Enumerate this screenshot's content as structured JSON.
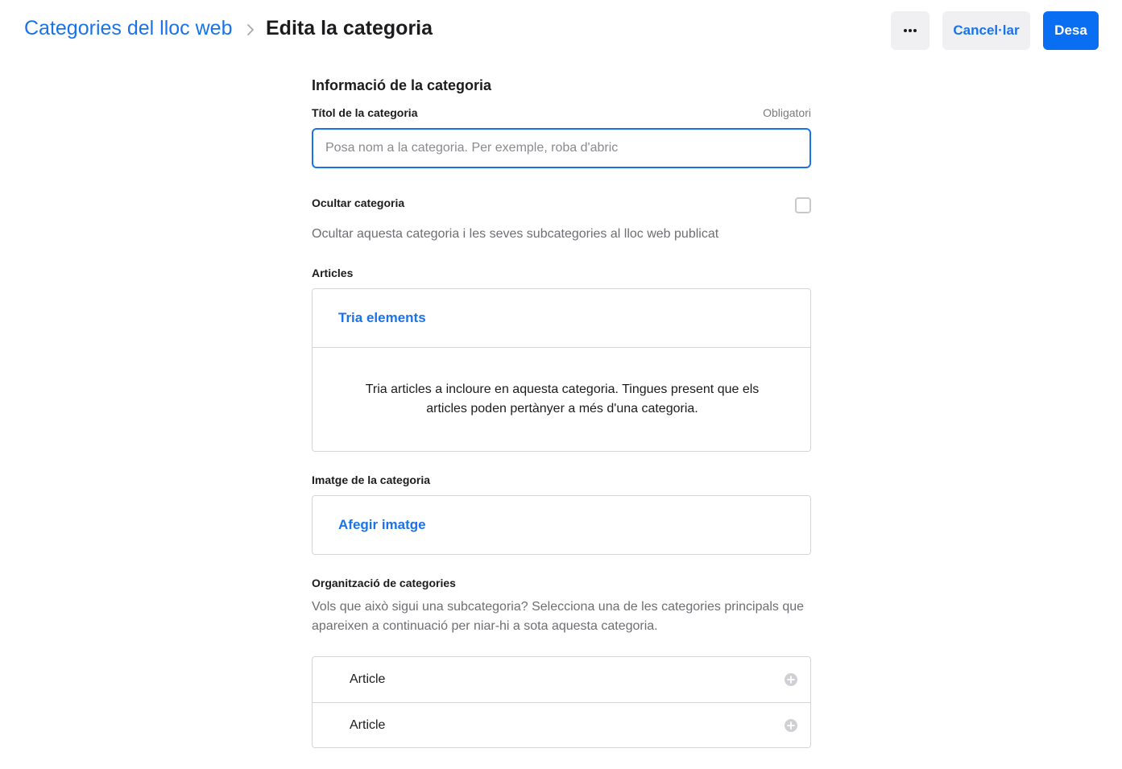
{
  "header": {
    "breadcrumb_parent": "Categories del lloc web",
    "page_title": "Edita la categoria",
    "more_label": "•••",
    "cancel_label": "Cancel·lar",
    "save_label": "Desa"
  },
  "form": {
    "section_title": "Informació de la categoria",
    "title_label": "Títol de la categoria",
    "required_text": "Obligatori",
    "title_value": "",
    "title_placeholder": "Posa nom a la categoria. Per exemple, roba d'abric",
    "hide_label": "Ocultar categoria",
    "hide_checked": false,
    "hide_help": "Ocultar aquesta categoria i les seves subcategories al lloc web publicat",
    "articles_label": "Articles",
    "choose_items_label": "Tria elements",
    "articles_help": "Tria articles a incloure en aquesta categoria. Tingues present que els articles poden pertànyer a més d'una categoria.",
    "image_label": "Imatge de la categoria",
    "add_image_label": "Afegir imatge",
    "organization_label": "Organització de categories",
    "organization_help": "Vols que això sigui una subcategoria? Selecciona una de les categories principals que apareixen a continuació per niar-hi a sota aquesta categoria.",
    "parent_categories": [
      {
        "label": "Article",
        "icon": "plus-circle-icon"
      },
      {
        "label": "Article",
        "icon": "plus-circle-icon"
      }
    ]
  },
  "colors": {
    "accent": "#1a73e8",
    "primary_button": "#0a6ef2",
    "secondary_button": "#f0f0f2",
    "border": "#d5d5d8",
    "muted_text": "#6e6e73"
  }
}
